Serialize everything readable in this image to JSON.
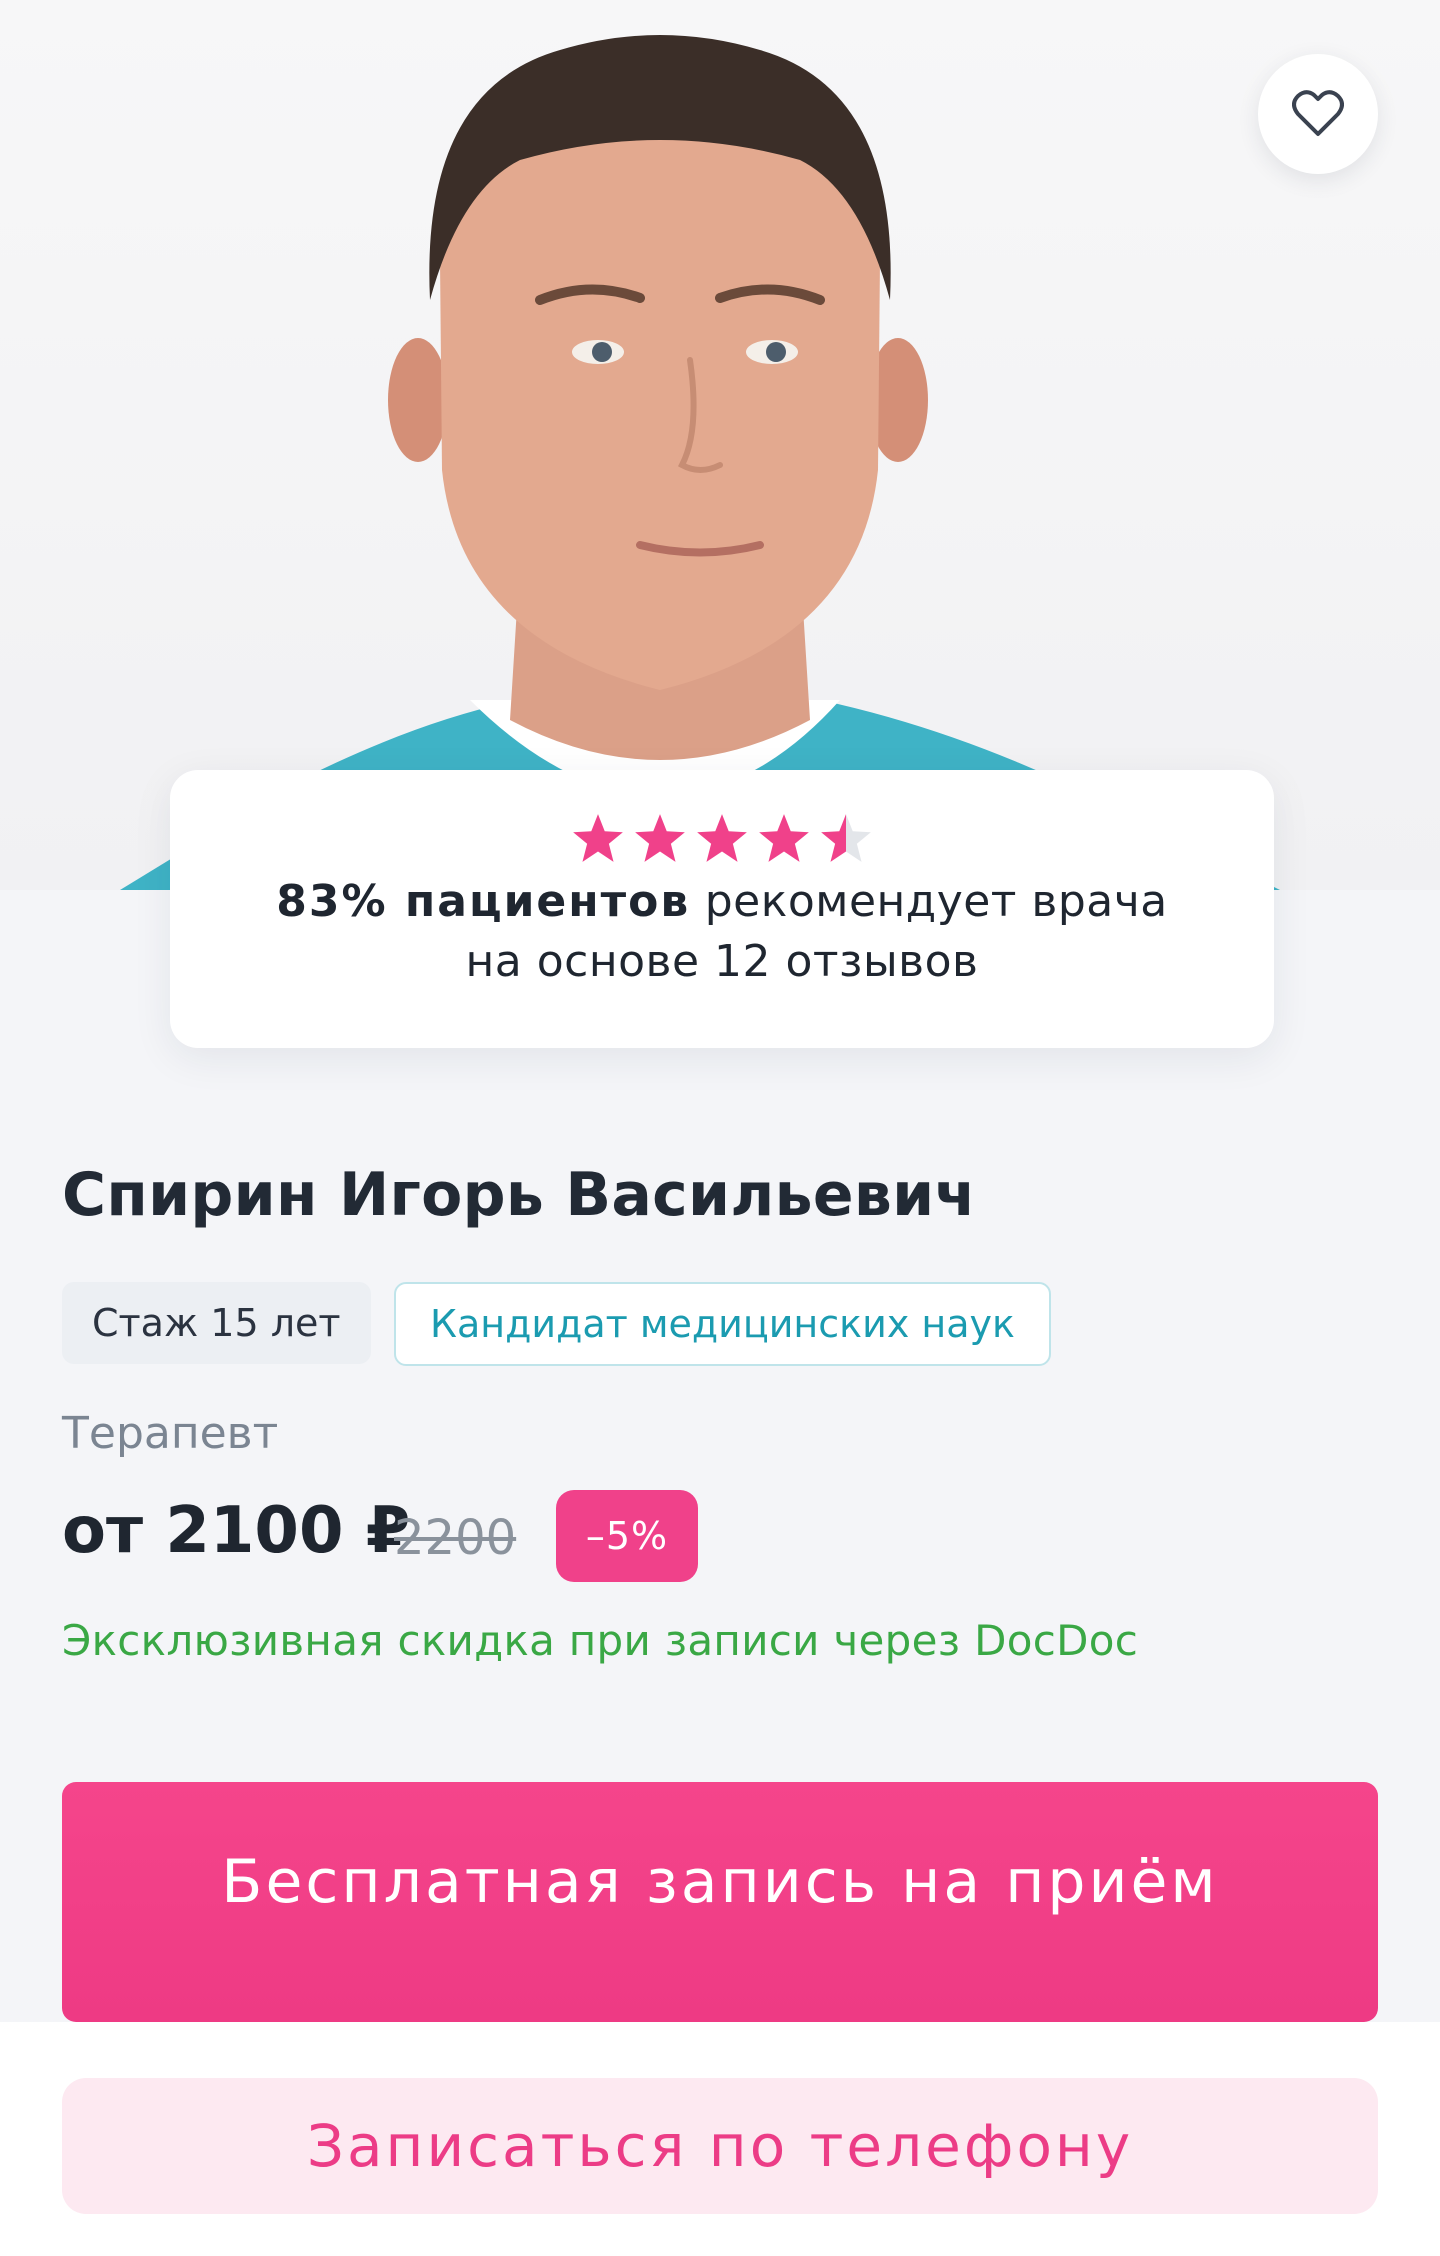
{
  "doctor": {
    "name": "Спирин Игорь Васильевич",
    "experience_tag": "Стаж 15 лет",
    "degree_tag": "Кандидат медицинских наук",
    "specialty": "Терапевт"
  },
  "rating": {
    "stars": 4.5,
    "max_stars": 5,
    "star_color": "#f0418a",
    "percent_bold": "83% пациентов",
    "recommend_text": " рекомендует врача",
    "based_on": "на основе 12 отзывов"
  },
  "price": {
    "current": "от 2100 ₽",
    "old": "2200",
    "discount": "–5%",
    "promo": "Эксклюзивная скидка при записи через DocDoc"
  },
  "actions": {
    "book_label": "Бесплатная запись на приём",
    "phone_label": "Записаться по телефону"
  },
  "icons": {
    "favorite": "heart-icon",
    "star": "star-icon"
  },
  "colors": {
    "accent": "#f0418a",
    "promo_green": "#3aa845",
    "degree_teal": "#1b9bb0"
  }
}
